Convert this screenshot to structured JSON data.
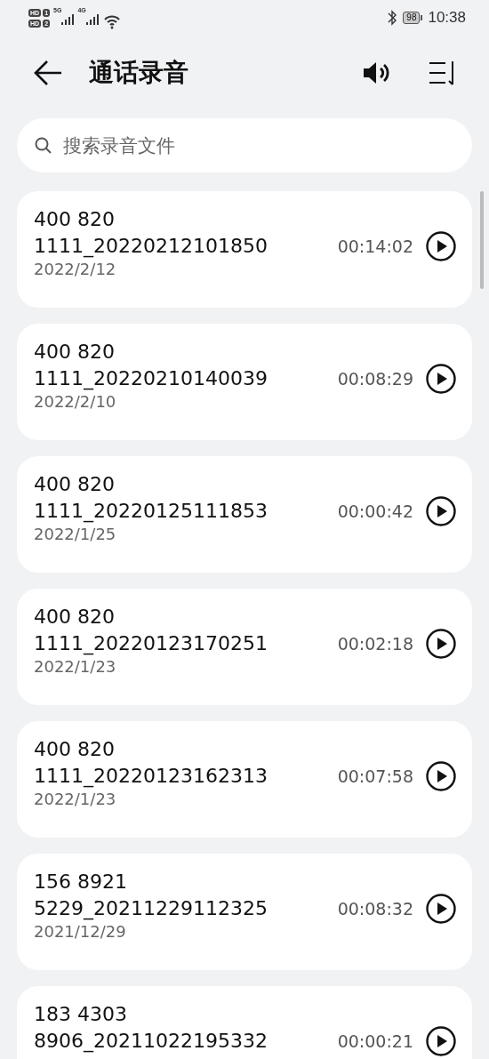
{
  "status_bar": {
    "sims": [
      {
        "label": "HD",
        "number": "1"
      },
      {
        "label": "HD",
        "number": "2"
      }
    ],
    "networks": [
      "5G",
      "4G"
    ],
    "battery": "98",
    "time": "10:38"
  },
  "header": {
    "title": "通话录音"
  },
  "search": {
    "placeholder": "搜索录音文件"
  },
  "recordings": [
    {
      "name": "400 820 1111_20220212101850",
      "date": "2022/2/12",
      "duration": "00:14:02"
    },
    {
      "name": "400 820 1111_20220210140039",
      "date": "2022/2/10",
      "duration": "00:08:29"
    },
    {
      "name": "400 820 1111_20220125111853",
      "date": "2022/1/25",
      "duration": "00:00:42"
    },
    {
      "name": "400 820 1111_20220123170251",
      "date": "2022/1/23",
      "duration": "00:02:18"
    },
    {
      "name": "400 820 1111_20220123162313",
      "date": "2022/1/23",
      "duration": "00:07:58"
    },
    {
      "name": "156 8921 5229_20211229112325",
      "date": "2021/12/29",
      "duration": "00:08:32"
    },
    {
      "name": "183 4303 8906_20211022195332",
      "duration": "00:00:21"
    }
  ]
}
